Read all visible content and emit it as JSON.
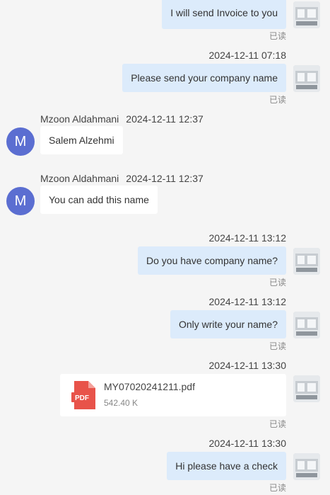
{
  "messages": [
    {
      "text": "I will send Invoice to you",
      "status": "已读"
    },
    {
      "time": "2024-12-11 07:18",
      "text": "Please send your company name",
      "status": "已读"
    },
    {
      "sender": "Mzoon Aldahmani",
      "time": "2024-12-11 12:37",
      "avatar_letter": "M",
      "text": "Salem Alzehmi"
    },
    {
      "sender": "Mzoon Aldahmani",
      "time": "2024-12-11 12:37",
      "avatar_letter": "M",
      "text": "You can add this name"
    },
    {
      "time": "2024-12-11 13:12",
      "text": "Do you have company name?",
      "status": "已读"
    },
    {
      "time": "2024-12-11 13:12",
      "text": "Only write your name?",
      "status": "已读"
    },
    {
      "time": "2024-12-11 13:30",
      "file": {
        "icon_label": "PDF",
        "name": "MY07020241211.pdf",
        "size": "542.40 K"
      },
      "status": "已读"
    },
    {
      "time": "2024-12-11 13:30",
      "text": "Hi please have a check",
      "status": "已读"
    }
  ],
  "colors": {
    "outgoing_bubble": "#dcebfb",
    "incoming_bubble": "#ffffff",
    "avatar": "#5b6ed1",
    "pdf": "#e8534a"
  }
}
